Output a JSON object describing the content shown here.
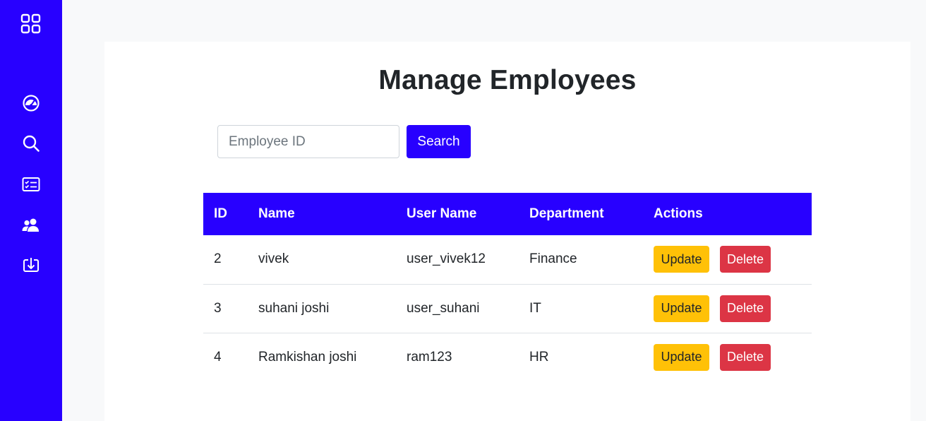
{
  "theme": {
    "accent": "#2800ff",
    "update_color": "#ffc107",
    "delete_color": "#dc3545"
  },
  "sidebar": {
    "icons": [
      "grid-icon",
      "dashboard-gauge-icon",
      "search-icon",
      "id-card-checklist-icon",
      "people-icon",
      "download-icon"
    ]
  },
  "page": {
    "title": "Manage Employees"
  },
  "search": {
    "placeholder": "Employee ID",
    "value": "",
    "button_label": "Search"
  },
  "table": {
    "headers": [
      "ID",
      "Name",
      "User Name",
      "Department",
      "Actions"
    ],
    "rows": [
      {
        "id": "2",
        "name": "vivek",
        "username": "user_vivek12",
        "department": "Finance",
        "update_label": "Update",
        "delete_label": "Delete"
      },
      {
        "id": "3",
        "name": "suhani joshi",
        "username": "user_suhani",
        "department": "IT",
        "update_label": "Update",
        "delete_label": "Delete"
      },
      {
        "id": "4",
        "name": "Ramkishan joshi",
        "username": "ram123",
        "department": "HR",
        "update_label": "Update",
        "delete_label": "Delete"
      }
    ]
  }
}
